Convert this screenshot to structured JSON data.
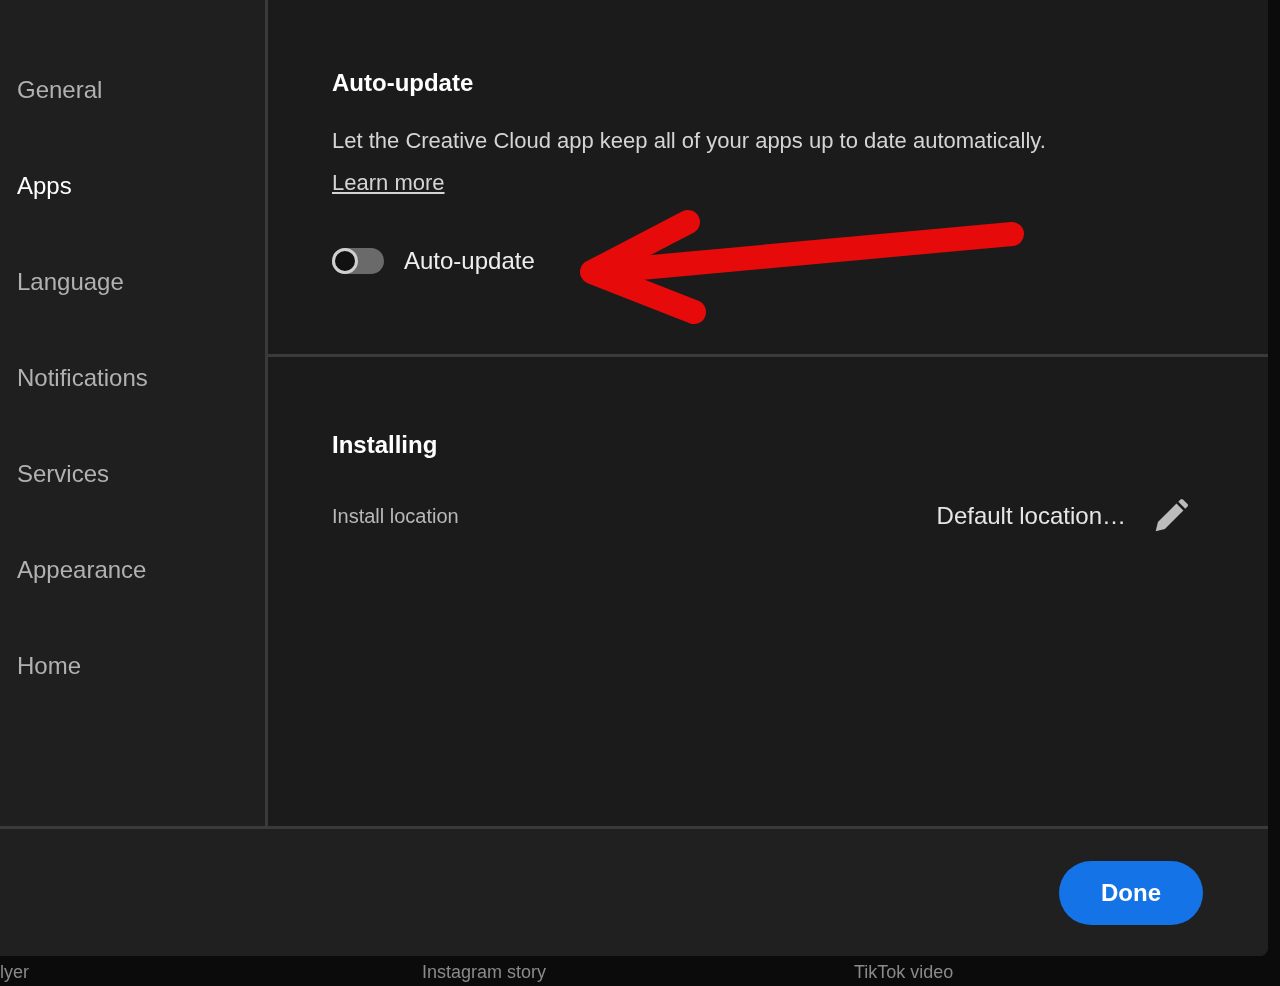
{
  "sidebar": {
    "items": [
      {
        "label": "General",
        "selected": false
      },
      {
        "label": "Apps",
        "selected": true
      },
      {
        "label": "Language",
        "selected": false
      },
      {
        "label": "Notifications",
        "selected": false
      },
      {
        "label": "Services",
        "selected": false
      },
      {
        "label": "Appearance",
        "selected": false
      },
      {
        "label": "Home",
        "selected": false
      }
    ]
  },
  "auto_update": {
    "title": "Auto-update",
    "description": "Let the Creative Cloud app keep all of your apps up to date automatically.",
    "link": "Learn more",
    "toggle": {
      "label": "Auto-update",
      "on": false
    }
  },
  "installing": {
    "title": "Installing",
    "rows": [
      {
        "label": "Install location",
        "value": "Default location…"
      }
    ]
  },
  "footer": {
    "button": "Done"
  },
  "background_items": [
    "lyer",
    "Instagram story",
    "TikTok video"
  ]
}
